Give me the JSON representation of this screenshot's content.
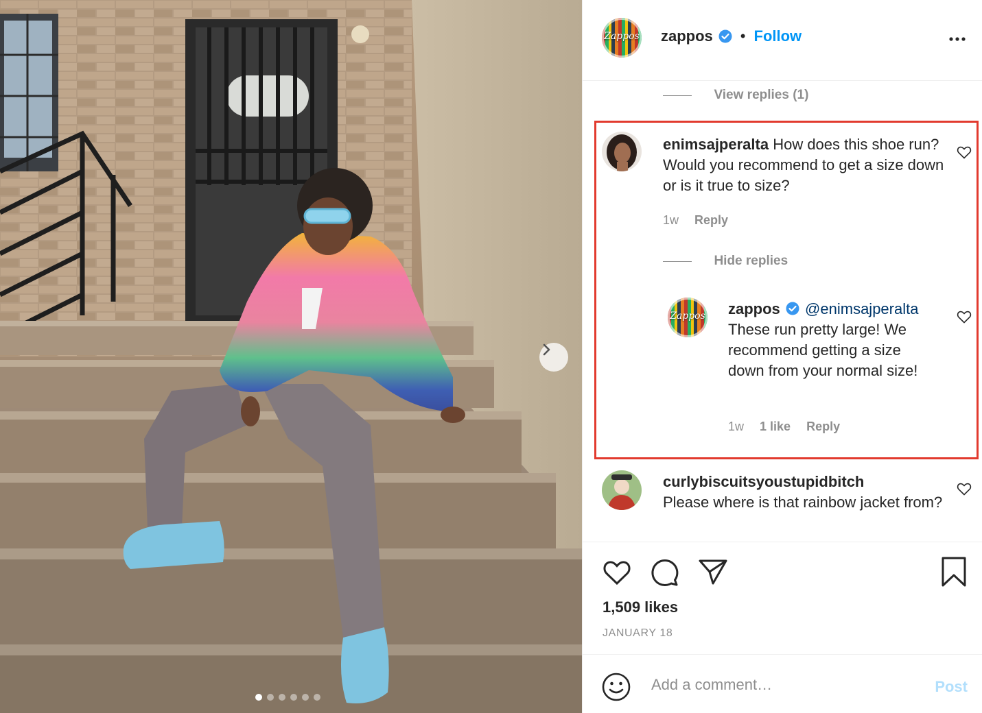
{
  "post": {
    "author": "zappos",
    "avatar_text": "Zappos",
    "follow_label": "Follow",
    "separator": "•",
    "carousel": {
      "total_slides": 6,
      "current_slide": 1
    }
  },
  "comments": {
    "view_replies_label": "View replies (1)",
    "highlight_color": "#e23a2e",
    "items": [
      {
        "username": "enimsajperalta",
        "text": "How does this shoe run? Would you recommend to get a size down or is it true to size?",
        "time": "1w",
        "reply_label": "Reply",
        "hide_replies_label": "Hide replies",
        "replies": [
          {
            "username": "zappos",
            "avatar_text": "Zappos",
            "mention": "@enimsajperalta",
            "text": "These run pretty large! We recommend getting a size down from your normal size!",
            "time": "1w",
            "likes_label": "1 like",
            "reply_label": "Reply"
          }
        ]
      },
      {
        "username": "curlybiscuitsyoustupidbitch",
        "text": "Please where is that rainbow jacket from?"
      }
    ]
  },
  "stats": {
    "likes": "1,509 likes",
    "date": "JANUARY 18"
  },
  "composer": {
    "placeholder": "Add a comment…",
    "post_label": "Post"
  },
  "icons": {
    "like": "heart-icon",
    "comment": "comment-bubble-icon",
    "share": "paper-plane-icon",
    "save": "bookmark-icon",
    "emoji": "smiley-icon",
    "more": "more-options-icon",
    "verified": "verified-badge-icon",
    "next": "chevron-right-icon"
  },
  "colors": {
    "link_blue": "#0095f6",
    "post_disabled": "#b2dffc",
    "muted": "#8e8e8e"
  }
}
